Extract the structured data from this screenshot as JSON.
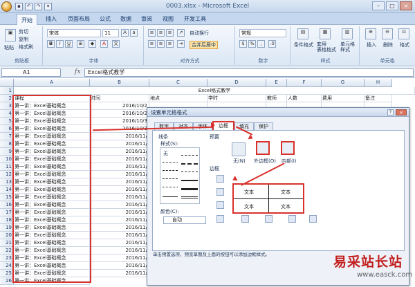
{
  "window": {
    "title": "0003.xlsx - Microsoft Excel"
  },
  "ribbon_tabs": [
    "开始",
    "插入",
    "页面布局",
    "公式",
    "数据",
    "审阅",
    "视图",
    "开发工具"
  ],
  "ribbon": {
    "paste": "粘贴",
    "cut": "剪切",
    "copy": "复制",
    "format_painter": "格式刷",
    "font_name": "宋体",
    "font_size": "11",
    "wrap_text": "自动换行",
    "merge_center": "合并后居中",
    "number_format": "常规",
    "conditional_format": "条件格式",
    "table_format": "套用\n表格格式",
    "cell_style": "单元格\n样式",
    "insert": "插入",
    "delete": "删除",
    "format": "格式",
    "groups": {
      "clipboard": "剪贴板",
      "font": "字体",
      "alignment": "对齐方式",
      "number": "数字",
      "styles": "样式",
      "cells": "单元格"
    }
  },
  "formula_bar": {
    "name_box": "A1",
    "fx": "fx",
    "content": "Excel格式教学"
  },
  "sheet": {
    "columns": [
      "A",
      "B",
      "C",
      "D",
      "E",
      "F",
      "G",
      "H"
    ],
    "title_row": "Excel格式教学",
    "headers": [
      "课程",
      "时间",
      "地点",
      "学时",
      "教师",
      "人数",
      "费用",
      "备注"
    ],
    "row_numbers": [
      "1",
      "2",
      "3",
      "4",
      "5",
      "6",
      "7",
      "8",
      "9",
      "10",
      "11",
      "12",
      "13",
      "14",
      "15",
      "16",
      "17",
      "18",
      "19",
      "20",
      "21",
      "22",
      "23",
      "24",
      "25",
      "26"
    ],
    "course": "第一讲：Excel基础概念",
    "dates": [
      "2016/10/2",
      "2016/10/2",
      "2016/10/3",
      "2016/10/3",
      "2016/11/",
      "2016/11/",
      "2016/11/",
      "2016/11/",
      "2016/11/",
      "2016/11/",
      "2016/11/",
      "2016/11/",
      "2016/11/",
      "2016/11/",
      "2016/11/",
      "2016/11/",
      "2016/11/",
      "2016/11/",
      "2016/11/",
      "2016/11/",
      "2016/11/",
      "2016/11/",
      "2016/11/"
    ]
  },
  "dialog": {
    "title": "设置单元格格式",
    "help": "?",
    "close": "×",
    "tabs": [
      "数字",
      "对齐",
      "字体",
      "边框",
      "填充",
      "保护"
    ],
    "active_tab": "边框",
    "line_section": "线条",
    "style_label": "样式(S):",
    "none_style": "无",
    "color_label": "颜色(C):",
    "color_value": "自动",
    "presets_label": "预置",
    "presets": [
      "无(N)",
      "外边框(O)",
      "内部(I)"
    ],
    "border_label": "边框",
    "preview_text": "文本",
    "note": "单击预置选项、预览草图及上面的按钮可以添加边框样式。"
  },
  "watermark": {
    "line1": "易采站长站",
    "line2": "www.easck.com"
  }
}
